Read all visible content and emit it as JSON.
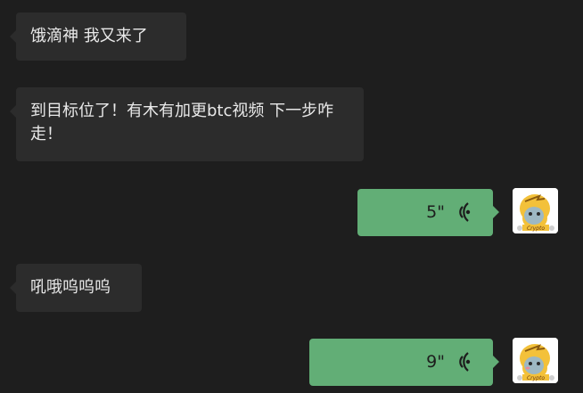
{
  "messages": [
    {
      "direction": "incoming",
      "text": "饿滴神 我又来了"
    },
    {
      "direction": "incoming",
      "text": "到目标位了！有木有加更btc视频 下一步咋走！"
    },
    {
      "direction": "outgoing",
      "type": "voice",
      "duration": "5\"",
      "icon": "voice-wave-icon",
      "avatar_icon": "crypto-avatar"
    },
    {
      "direction": "incoming",
      "text": "吼哦呜呜呜"
    },
    {
      "direction": "outgoing",
      "type": "voice",
      "duration": "9\"",
      "icon": "voice-wave-icon",
      "avatar_icon": "crypto-avatar"
    }
  ],
  "avatar": {
    "label": "Crypto"
  },
  "colors": {
    "background": "#1e1e1e",
    "incoming_bubble": "#2c2c2c",
    "outgoing_bubble": "#62ae76",
    "avatar_yellow": "#f3c13a"
  }
}
